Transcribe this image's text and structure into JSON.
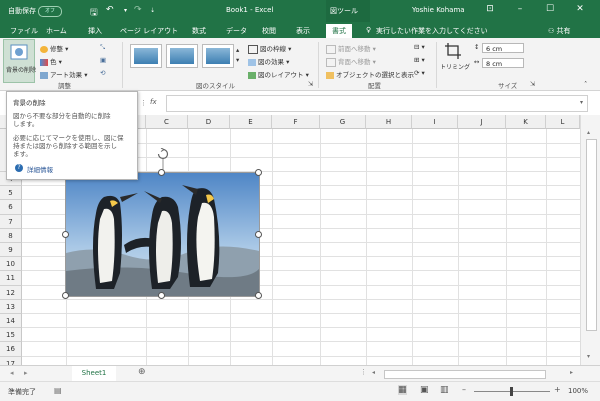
{
  "window": {
    "autosave_label": "自動保存",
    "autosave_state": "オフ",
    "title": "Book1 - Excel",
    "context_tab_group": "図ツール",
    "user": "Yoshie Kohama"
  },
  "tabs": [
    "ファイル",
    "ホーム",
    "挿入",
    "ページ レイアウト",
    "数式",
    "データ",
    "校閲",
    "表示",
    "書式"
  ],
  "active_tab": "書式",
  "tell_me": "実行したい作業を入力してください",
  "share": "共有",
  "ribbon": {
    "remove_bg_label": "背景の削除",
    "adjust": {
      "corrections": "修整",
      "color": "色",
      "artistic": "アート効果",
      "group_label": "調整"
    },
    "styles": {
      "border": "図の枠線",
      "effects": "図の効果",
      "layout": "図のレイアウト",
      "group_label": "図のスタイル"
    },
    "arrange": {
      "bring_forward": "前面へ移動",
      "send_backward": "背面へ移動",
      "selection_pane": "オブジェクトの選択と表示",
      "group_label": "配置"
    },
    "size": {
      "crop": "トリミング",
      "height": "6 cm",
      "width": "8 cm",
      "group_label": "サイズ"
    }
  },
  "tooltip": {
    "title": "背景の削除",
    "line1": "図から不要な部分を自動的に削除",
    "line2": "します。",
    "line3": "必要に応じてマークを使用し、図に保",
    "line4": "持または図から削除する範囲を示し",
    "line5": "ます。",
    "more": "詳細情報"
  },
  "formula_bar": {
    "fx": "fx",
    "value": ""
  },
  "columns": [
    "C",
    "D",
    "E",
    "F",
    "G",
    "H",
    "I",
    "J",
    "K",
    "L"
  ],
  "rows": [
    "4",
    "5",
    "6",
    "7",
    "8",
    "9",
    "10",
    "11",
    "12",
    "13",
    "14",
    "15",
    "16",
    "17"
  ],
  "sheet_tab": "Sheet1",
  "status": {
    "ready": "準備完了",
    "zoom": "100%"
  },
  "colors": {
    "accent": "#217346",
    "ribbon_bg": "#f3f3f3"
  }
}
